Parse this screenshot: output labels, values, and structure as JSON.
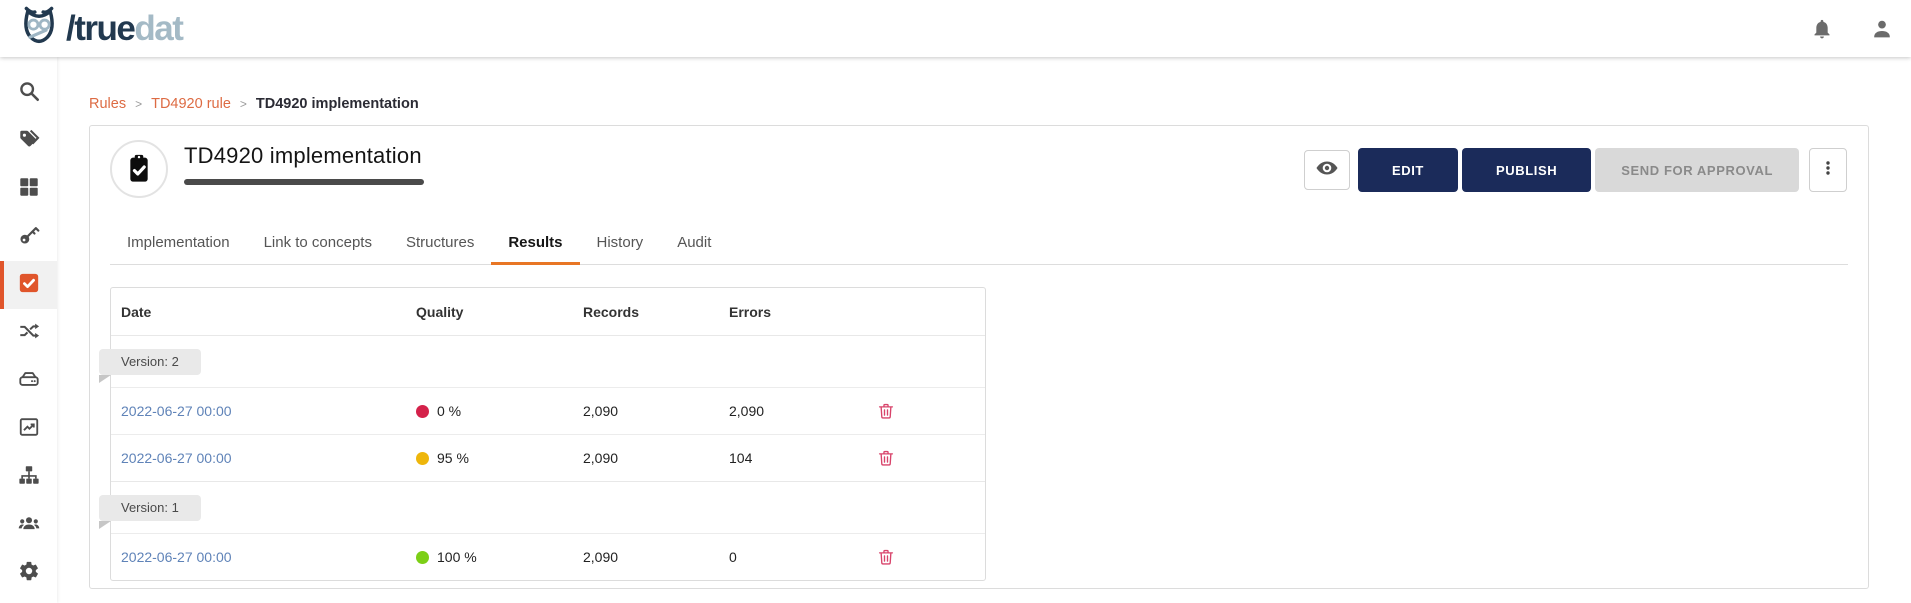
{
  "brand": {
    "logo_icon": "owl-icon",
    "wordmark_primary": "/true",
    "wordmark_secondary": "dat"
  },
  "topbar": {
    "icons": [
      "bell-icon",
      "user-icon"
    ]
  },
  "sidebar": {
    "items": [
      {
        "icon": "search-icon",
        "active": false
      },
      {
        "icon": "tags-icon",
        "active": false
      },
      {
        "icon": "grid-icon",
        "active": false
      },
      {
        "icon": "key-icon",
        "active": false
      },
      {
        "icon": "check-square-icon",
        "active": true
      },
      {
        "icon": "shuffle-icon",
        "active": false
      },
      {
        "icon": "hard-drive-icon",
        "active": false
      },
      {
        "icon": "chart-icon",
        "active": false
      },
      {
        "icon": "sitemap-icon",
        "active": false
      },
      {
        "icon": "users-icon",
        "active": false
      },
      {
        "icon": "gear-icon",
        "active": false
      }
    ]
  },
  "breadcrumb": {
    "separator": ">",
    "items": [
      {
        "label": "Rules",
        "link": true
      },
      {
        "label": "TD4920 rule",
        "link": true
      },
      {
        "label": "TD4920 implementation",
        "link": false
      }
    ]
  },
  "header": {
    "entity_icon": "clipboard-check-icon",
    "title": "TD4920 implementation",
    "actions": {
      "preview_icon": "eye-icon",
      "edit": "EDIT",
      "publish": "PUBLISH",
      "send_for_approval": "SEND FOR APPROVAL",
      "more_icon": "kebab-menu-icon"
    }
  },
  "tabs": [
    {
      "label": "Implementation",
      "active": false
    },
    {
      "label": "Link to concepts",
      "active": false
    },
    {
      "label": "Structures",
      "active": false
    },
    {
      "label": "Results",
      "active": true
    },
    {
      "label": "History",
      "active": false
    },
    {
      "label": "Audit",
      "active": false
    }
  ],
  "table": {
    "columns": [
      "Date",
      "Quality",
      "Records",
      "Errors"
    ],
    "groups": [
      {
        "version_label": "Version: 2",
        "rows": [
          {
            "date": "2022-06-27 00:00",
            "quality": "0 %",
            "quality_color": "#d4214a",
            "records": "2,090",
            "errors": "2,090"
          },
          {
            "date": "2022-06-27 00:00",
            "quality": "95 %",
            "quality_color": "#eeb60b",
            "records": "2,090",
            "errors": "104"
          }
        ]
      },
      {
        "version_label": "Version: 1",
        "rows": [
          {
            "date": "2022-06-27 00:00",
            "quality": "100 %",
            "quality_color": "#7ccf16",
            "records": "2,090",
            "errors": "0"
          }
        ]
      }
    ]
  },
  "colors": {
    "primary_navy": "#1b2b5a",
    "accent_orange": "#e87625",
    "sidebar_active": "#e0552b",
    "breadcrumb_link": "#dd6b43",
    "date_link": "#5f83b8",
    "quality_red": "#d4214a",
    "quality_yellow": "#eeb60b",
    "quality_green": "#7ccf16",
    "trash_red": "#d8436a"
  }
}
